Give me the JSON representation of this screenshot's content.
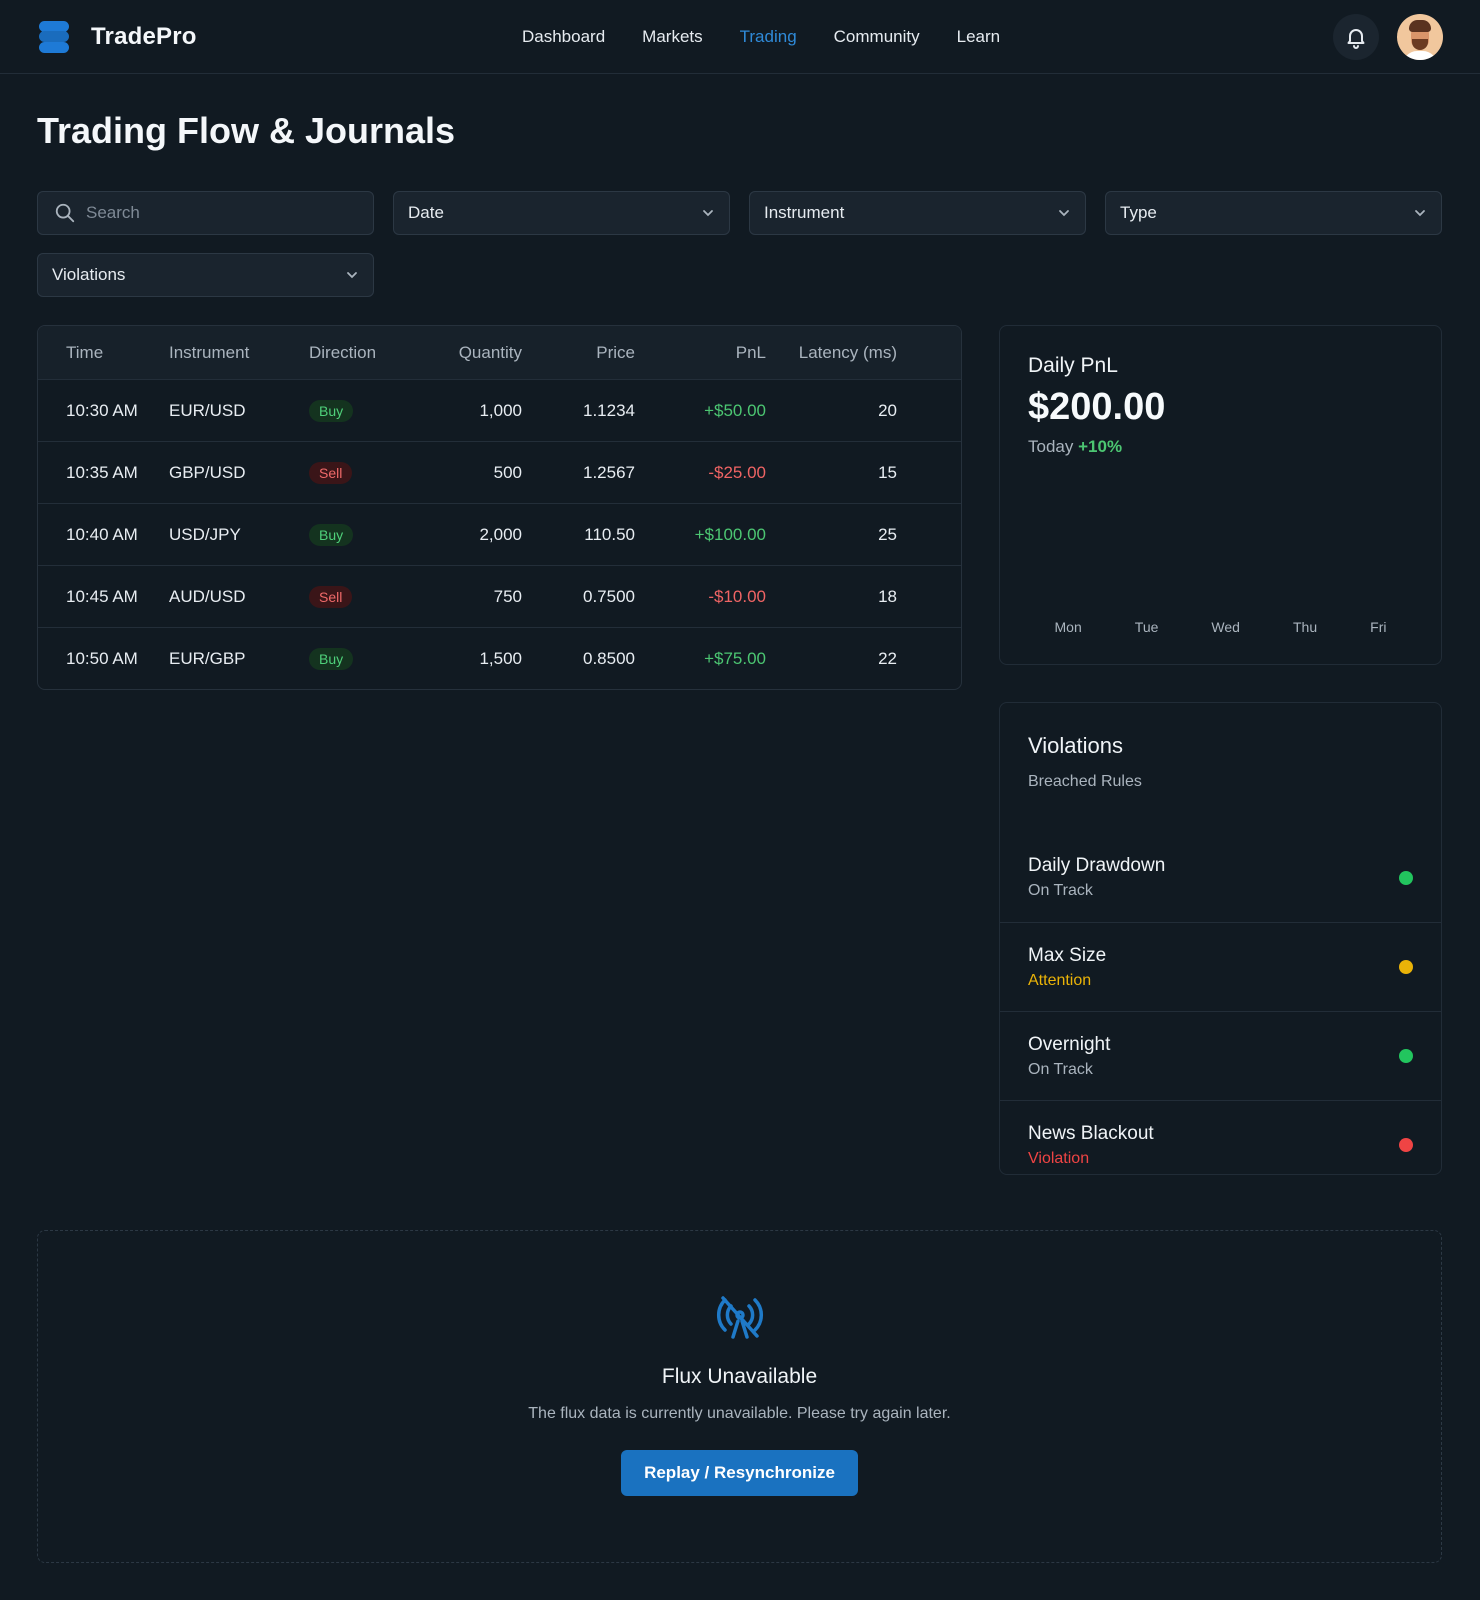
{
  "header": {
    "brand": "TradePro",
    "nav": [
      "Dashboard",
      "Markets",
      "Trading",
      "Community",
      "Learn"
    ],
    "active_nav": "Trading"
  },
  "page": {
    "title": "Trading Flow & Journals"
  },
  "filters": {
    "search_placeholder": "Search",
    "date": "Date",
    "instrument": "Instrument",
    "type": "Type",
    "violations": "Violations"
  },
  "table": {
    "headers": [
      "Time",
      "Instrument",
      "Direction",
      "Quantity",
      "Price",
      "PnL",
      "Latency (ms)"
    ],
    "rows": [
      {
        "time": "10:30 AM",
        "instrument": "EUR/USD",
        "direction": "Buy",
        "quantity": "1,000",
        "price": "1.1234",
        "pnl": "+$50.00",
        "latency": "20"
      },
      {
        "time": "10:35 AM",
        "instrument": "GBP/USD",
        "direction": "Sell",
        "quantity": "500",
        "price": "1.2567",
        "pnl": "-$25.00",
        "latency": "15"
      },
      {
        "time": "10:40 AM",
        "instrument": "USD/JPY",
        "direction": "Buy",
        "quantity": "2,000",
        "price": "110.50",
        "pnl": "+$100.00",
        "latency": "25"
      },
      {
        "time": "10:45 AM",
        "instrument": "AUD/USD",
        "direction": "Sell",
        "quantity": "750",
        "price": "0.7500",
        "pnl": "-$10.00",
        "latency": "18"
      },
      {
        "time": "10:50 AM",
        "instrument": "EUR/GBP",
        "direction": "Buy",
        "quantity": "1,500",
        "price": "0.8500",
        "pnl": "+$75.00",
        "latency": "22"
      }
    ]
  },
  "daily_pnl": {
    "title": "Daily PnL",
    "value": "$200.00",
    "period": "Today",
    "change": "+10%",
    "days": [
      "Mon",
      "Tue",
      "Wed",
      "Thu",
      "Fri"
    ]
  },
  "violations": {
    "title": "Violations",
    "subtitle": "Breached Rules",
    "items": [
      {
        "name": "Daily Drawdown",
        "status": "On Track",
        "status_color": "#aab4be",
        "dot_color": "#22c55e"
      },
      {
        "name": "Max Size",
        "status": "Attention",
        "status_color": "#eab308",
        "dot_color": "#eab308"
      },
      {
        "name": "Overnight",
        "status": "On Track",
        "status_color": "#aab4be",
        "dot_color": "#22c55e"
      },
      {
        "name": "News Blackout",
        "status": "Violation",
        "status_color": "#ef4444",
        "dot_color": "#ef4444"
      }
    ]
  },
  "flux": {
    "title": "Flux Unavailable",
    "message": "The flux data is currently unavailable. Please try again later.",
    "button": "Replay / Resynchronize"
  },
  "colors": {
    "accent": "#2f8ad8",
    "positive": "#4cc672",
    "negative": "#ef6464",
    "background": "#111a22"
  },
  "icons": [
    "brand-logo-icon",
    "bell-icon",
    "avatar",
    "search-icon",
    "chevron-down-icon",
    "signal-off-icon"
  ]
}
